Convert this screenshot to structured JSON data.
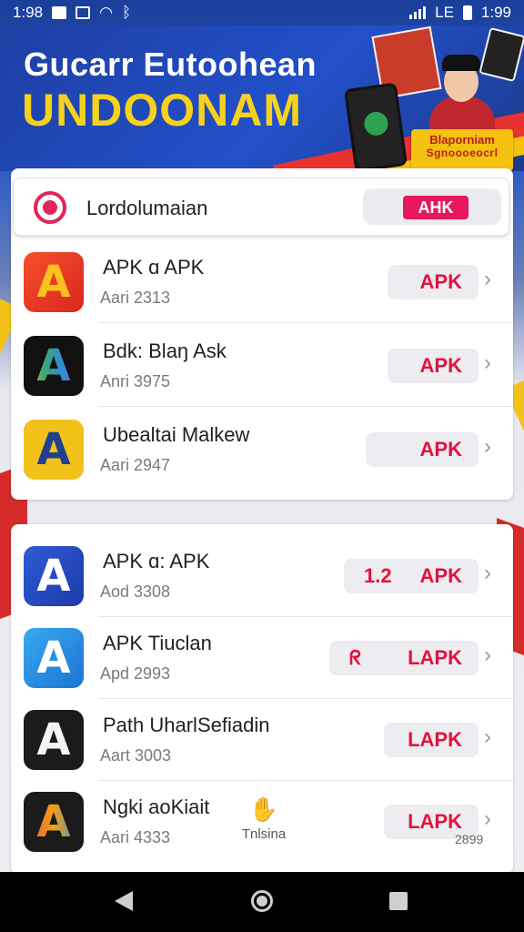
{
  "status_bar": {
    "time_left": "1:98",
    "network": "LЕ",
    "time_right": "1:99"
  },
  "banner": {
    "title_line1": "Gucarr Eutoohean",
    "title_line2": "UNDOONAM",
    "tag_line1": "Blaporniam",
    "tag_line2": "Sgnoooeocrl"
  },
  "search": {
    "text": "Lordolumaian",
    "button": "AHK"
  },
  "apps_top": [
    {
      "name": "APK ɑ APK",
      "sub": "Aari 2313",
      "button": "APK"
    },
    {
      "name": "Bdk: Blaŋ Ask",
      "sub": "Anri 3975",
      "button": "APK"
    },
    {
      "name": "Ubealtai Malkew",
      "sub": "Aari 2947",
      "button": "APK"
    }
  ],
  "apps_bottom": [
    {
      "name": "APK ɑ: APK",
      "sub": "Aod 3308",
      "button_prefix": "1.2",
      "button": "APK"
    },
    {
      "name": "APK Tiuclan",
      "sub": "Apd 2993",
      "button_prefix": "ᖇ",
      "button": "LAPK"
    },
    {
      "name": "Path UharlSefiadin",
      "sub": "Aart 3003",
      "button": "LAPK"
    },
    {
      "name": "Ngki aoKiait",
      "sub": "Aari 4333",
      "button": "LAPK"
    }
  ],
  "floating": {
    "label": "Tnlsina",
    "corner_number": "2899"
  },
  "icons": {
    "status": [
      "image-icon",
      "square-icon",
      "wifi-icon",
      "bluetooth-icon",
      "signal-icon",
      "battery-icon"
    ],
    "nav": [
      "back-icon",
      "home-icon",
      "recent-apps-icon"
    ],
    "chevron": "chevron-right-icon"
  },
  "colors": {
    "accent": "#e6175c",
    "apk_text": "#e3123e",
    "banner_blue": "#2250c9",
    "banner_yellow": "#f6d21c"
  }
}
